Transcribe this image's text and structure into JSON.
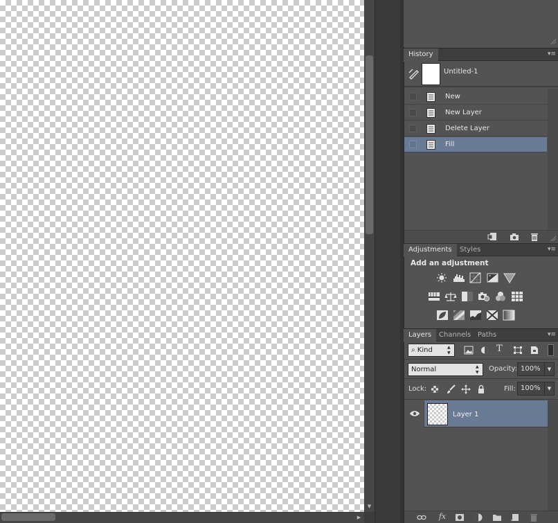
{
  "history": {
    "tab": "History",
    "snapshot": "Untitled-1",
    "states": [
      {
        "label": "New",
        "selected": false
      },
      {
        "label": "New Layer",
        "selected": false
      },
      {
        "label": "Delete Layer",
        "selected": false
      },
      {
        "label": "Fill",
        "selected": true
      }
    ],
    "footer_icons": [
      "new-document-from-state-icon",
      "camera-icon",
      "trash-icon"
    ]
  },
  "adjustments": {
    "tabs": [
      "Adjustments",
      "Styles"
    ],
    "title": "Add an adjustment",
    "row1": [
      "brightness-contrast-icon",
      "levels-icon",
      "curves-icon",
      "exposure-icon",
      "vibrance-icon"
    ],
    "row2": [
      "hue-saturation-icon",
      "color-balance-icon",
      "black-white-icon",
      "photo-filter-icon",
      "channel-mixer-icon",
      "color-lookup-icon"
    ],
    "row3": [
      "invert-icon",
      "posterize-icon",
      "threshold-icon",
      "selective-color-icon",
      "gradient-map-icon"
    ]
  },
  "layers": {
    "tabs": [
      "Layers",
      "Channels",
      "Paths"
    ],
    "filter_kind": "Kind",
    "blend_mode": "Normal",
    "opacity_label": "Opacity:",
    "opacity_value": "100%",
    "lock_label": "Lock:",
    "fill_label": "Fill:",
    "fill_value": "100%",
    "items": [
      {
        "name": "Layer 1",
        "visible": true,
        "selected": true
      }
    ],
    "footer_icons": [
      "link-icon",
      "fx-icon",
      "mask-icon",
      "adjustment-layer-icon",
      "group-folder-icon",
      "new-layer-icon",
      "trash-icon"
    ],
    "fx_label": "fx"
  },
  "colors": {
    "selection": "#6a7c95",
    "panel": "#535353",
    "tabbar": "#3e3e3e"
  }
}
